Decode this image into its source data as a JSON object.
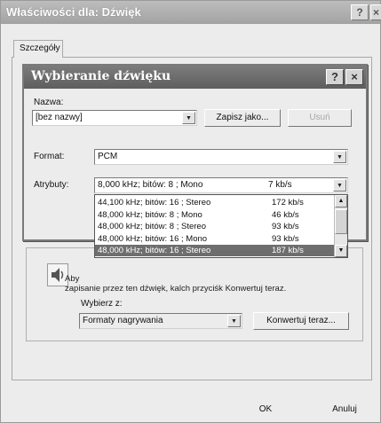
{
  "outer_window": {
    "title": "Właściwości dla: Dźwięk",
    "help_label": "?",
    "close_label": "×",
    "tab_label": "Szczegóły",
    "description_start": "Aby",
    "description_rest": "zapisanie przez ten dźwięk, kalch przyciśk Konwertuj teraz.",
    "choose_from_label": "Wybierz z:",
    "choose_from_value": "Formaty nagrywania",
    "convert_button": "Konwertuj teraz...",
    "ok_button": "OK",
    "cancel_button": "Anuluj"
  },
  "dialog": {
    "title": "Wybieranie dźwięku",
    "help_label": "?",
    "close_label": "×",
    "name_label": "Nazwa:",
    "name_value": "[bez nazwy]",
    "save_as_button": "Zapisz jako...",
    "delete_button": "Usuń",
    "format_label": "Format:",
    "format_value": "PCM",
    "attributes_label": "Atrybuty:",
    "attributes_value": "8,000 kHz; bitów: 8 ; Mono",
    "attributes_rate": "7 kb/s",
    "attribute_options": [
      {
        "format": "44,100 kHz; bitów: 16 ; Stereo",
        "rate": "172 kb/s",
        "selected": false
      },
      {
        "format": "48,000 kHz; bitów: 8 ; Mono",
        "rate": "46 kb/s",
        "selected": false
      },
      {
        "format": "48,000 kHz; bitów: 8 ; Stereo",
        "rate": "93 kb/s",
        "selected": false
      },
      {
        "format": "48,000 kHz; bitów: 16 ; Mono",
        "rate": "93 kb/s",
        "selected": false
      },
      {
        "format": "48,000 kHz; bitów: 16 ; Stereo",
        "rate": "187 kb/s",
        "selected": true
      }
    ]
  },
  "icons": {
    "dropdown": "chevron-down-icon",
    "scroll_up": "chevron-up-icon",
    "scroll_down": "chevron-down-icon",
    "speaker": "speaker-icon"
  }
}
